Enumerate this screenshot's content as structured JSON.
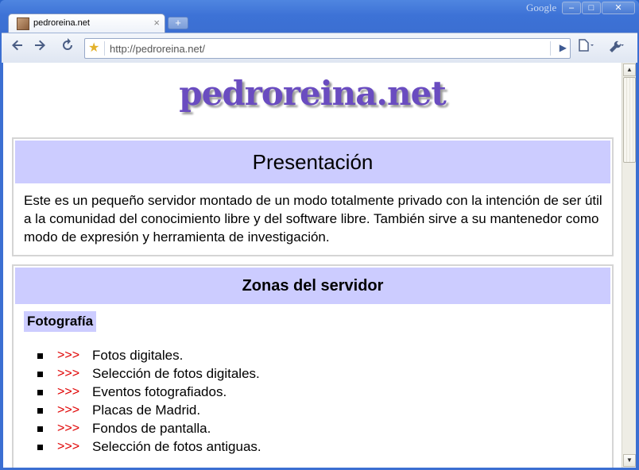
{
  "browser": {
    "tab_title": "pedroreina.net",
    "tab_close": "×",
    "new_tab": "+",
    "search_label": "Google",
    "window_buttons": {
      "minimize": "–",
      "maximize": "□",
      "close": "✕"
    },
    "url": "http://pedroreina.net/",
    "icons": [
      "back-icon",
      "forward-icon",
      "reload-icon",
      "star-icon",
      "go-icon",
      "page-menu-icon",
      "wrench-icon"
    ]
  },
  "page": {
    "logo": "pedroreina.net",
    "presentation": {
      "heading": "Presentación",
      "text": "Este es un pequeño servidor montado de un modo totalmente privado con la intención de ser útil a la comunidad del conocimiento libre y del software libre. También sirve a su mantenedor como modo de expresión y herramienta de investigación."
    },
    "zones": {
      "heading": "Zonas del servidor",
      "section": "Fotografía",
      "arrow": ">>>",
      "items": [
        "Fotos digitales.",
        "Selección de fotos digitales.",
        "Eventos fotografiados.",
        "Placas de Madrid.",
        "Fondos de pantalla.",
        "Selección de fotos antiguas."
      ]
    }
  },
  "colors": {
    "header_bg": "#ccccff",
    "arrow": "#e00000",
    "logo": "#6a4cc0"
  }
}
